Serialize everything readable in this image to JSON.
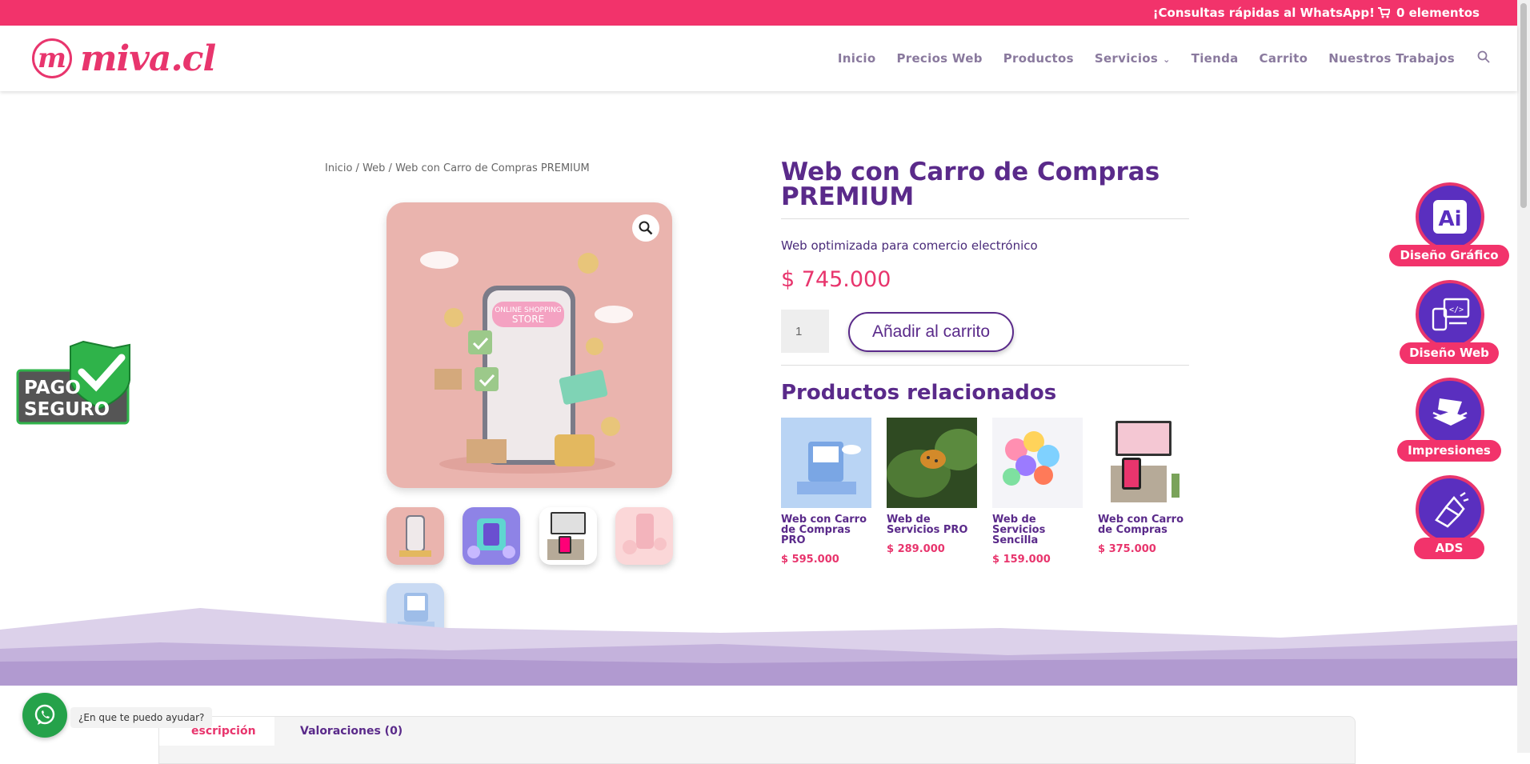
{
  "topbar": {
    "whatsapp": "¡Consultas rápidas al WhatsApp!",
    "cart": "0 elementos"
  },
  "brand": {
    "logo_mark": "m",
    "logo_text": "miva.cl"
  },
  "nav": {
    "items": [
      "Inicio",
      "Precios Web",
      "Productos",
      "Servicios",
      "Tienda",
      "Carrito",
      "Nuestros Trabajos"
    ]
  },
  "breadcrumb": {
    "home": "Inicio",
    "cat": "Web",
    "current": "Web con Carro de Compras PREMIUM"
  },
  "product": {
    "title": "Web con Carro de Compras PREMIUM",
    "short_desc": "Web optimizada para comercio electrónico",
    "price": "$ 745.000",
    "qty": "1",
    "add_to_cart": "Añadir al carrito",
    "image_text": "ONLINE SHOPPING STORE"
  },
  "related": {
    "heading": "Productos relacionados",
    "items": [
      {
        "name": "Web con Carro de Compras PRO",
        "price": "$ 595.000"
      },
      {
        "name": "Web de Servicios PRO",
        "price": "$ 289.000"
      },
      {
        "name": "Web de Servicios Sencilla",
        "price": "$ 159.000"
      },
      {
        "name": "Web con Carro de Compras",
        "price": "$ 375.000"
      }
    ]
  },
  "tabs": {
    "description": "escripción",
    "reviews": "Valoraciones (0)"
  },
  "whatsapp_widget": {
    "prompt": "¿En que te puedo ayudar?"
  },
  "seal": {
    "line1": "PAGO",
    "line2": "SEGURO"
  },
  "services": {
    "items": [
      "Diseño Gráfico",
      "Diseño Web",
      "Impresiones",
      "ADS"
    ]
  },
  "colors": {
    "brand_pink": "#f2336b",
    "brand_purple": "#5a2a8a",
    "whatsapp_green": "#25a24a"
  }
}
